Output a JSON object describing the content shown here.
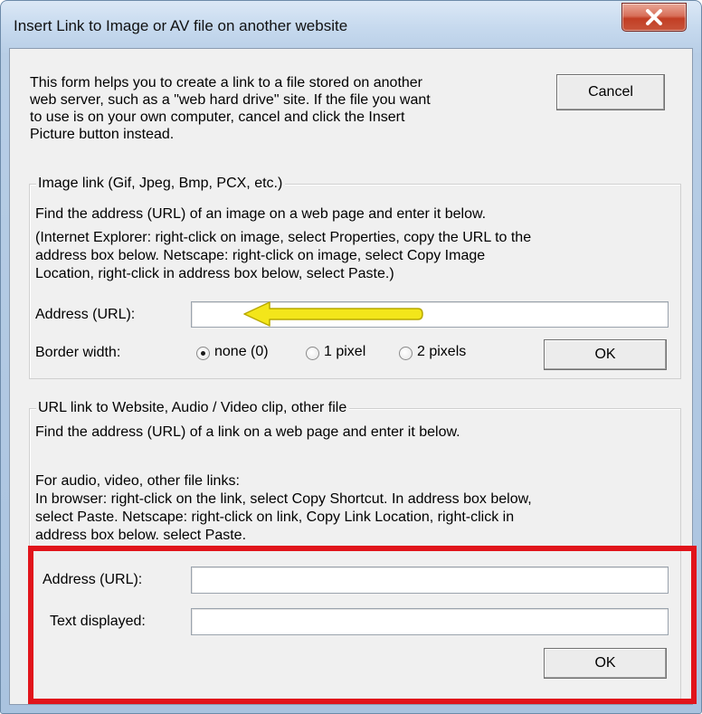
{
  "window": {
    "title": "Insert Link to Image or AV file on another website",
    "close_label": "X"
  },
  "intro": {
    "text": "This form helps you to create a link to a file stored on another\nweb server, such as a \"web hard drive\" site.  If the file you want\nto use is on your own computer, cancel and click the Insert\nPicture button instead."
  },
  "cancel_label": "Cancel",
  "image_group": {
    "legend": "Image link (Gif, Jpeg, Bmp, PCX, etc.)",
    "instruction": "Find the address (URL) of an image on a web page and enter it below.",
    "help_line1": "(Internet Explorer: right-click on image, select Properties, copy the URL to the",
    "help_line2": "address box below.    Netscape: right-click on image, select Copy Image",
    "help_line3": "Location, right-click in address box below, select Paste.)",
    "address_label": "Address (URL):",
    "address_value": "",
    "border_label": "Border width:",
    "border_options": [
      "none (0)",
      "1 pixel",
      "2 pixels"
    ],
    "border_selected": "none (0)",
    "ok_label": "OK"
  },
  "url_group": {
    "legend": "URL link to Website, Audio / Video clip, other file",
    "instruction": "Find the address (URL) of a link on a web page and enter it below.",
    "av_heading": "For audio, video, other file links:",
    "help_line1": "In browser: right-click on the link, select Copy Shortcut.  In address box below,",
    "help_line2": "select Paste.   Netscape: right-click on link, Copy Link Location, right-click in",
    "help_line3": "address box below, select Paste.",
    "address_label": "Address (URL):",
    "address_value": "",
    "text_label": "Text displayed:",
    "text_value": "",
    "ok_label": "OK"
  },
  "colors": {
    "highlight_border": "#e1141b",
    "arrow": "#f3e61a"
  }
}
